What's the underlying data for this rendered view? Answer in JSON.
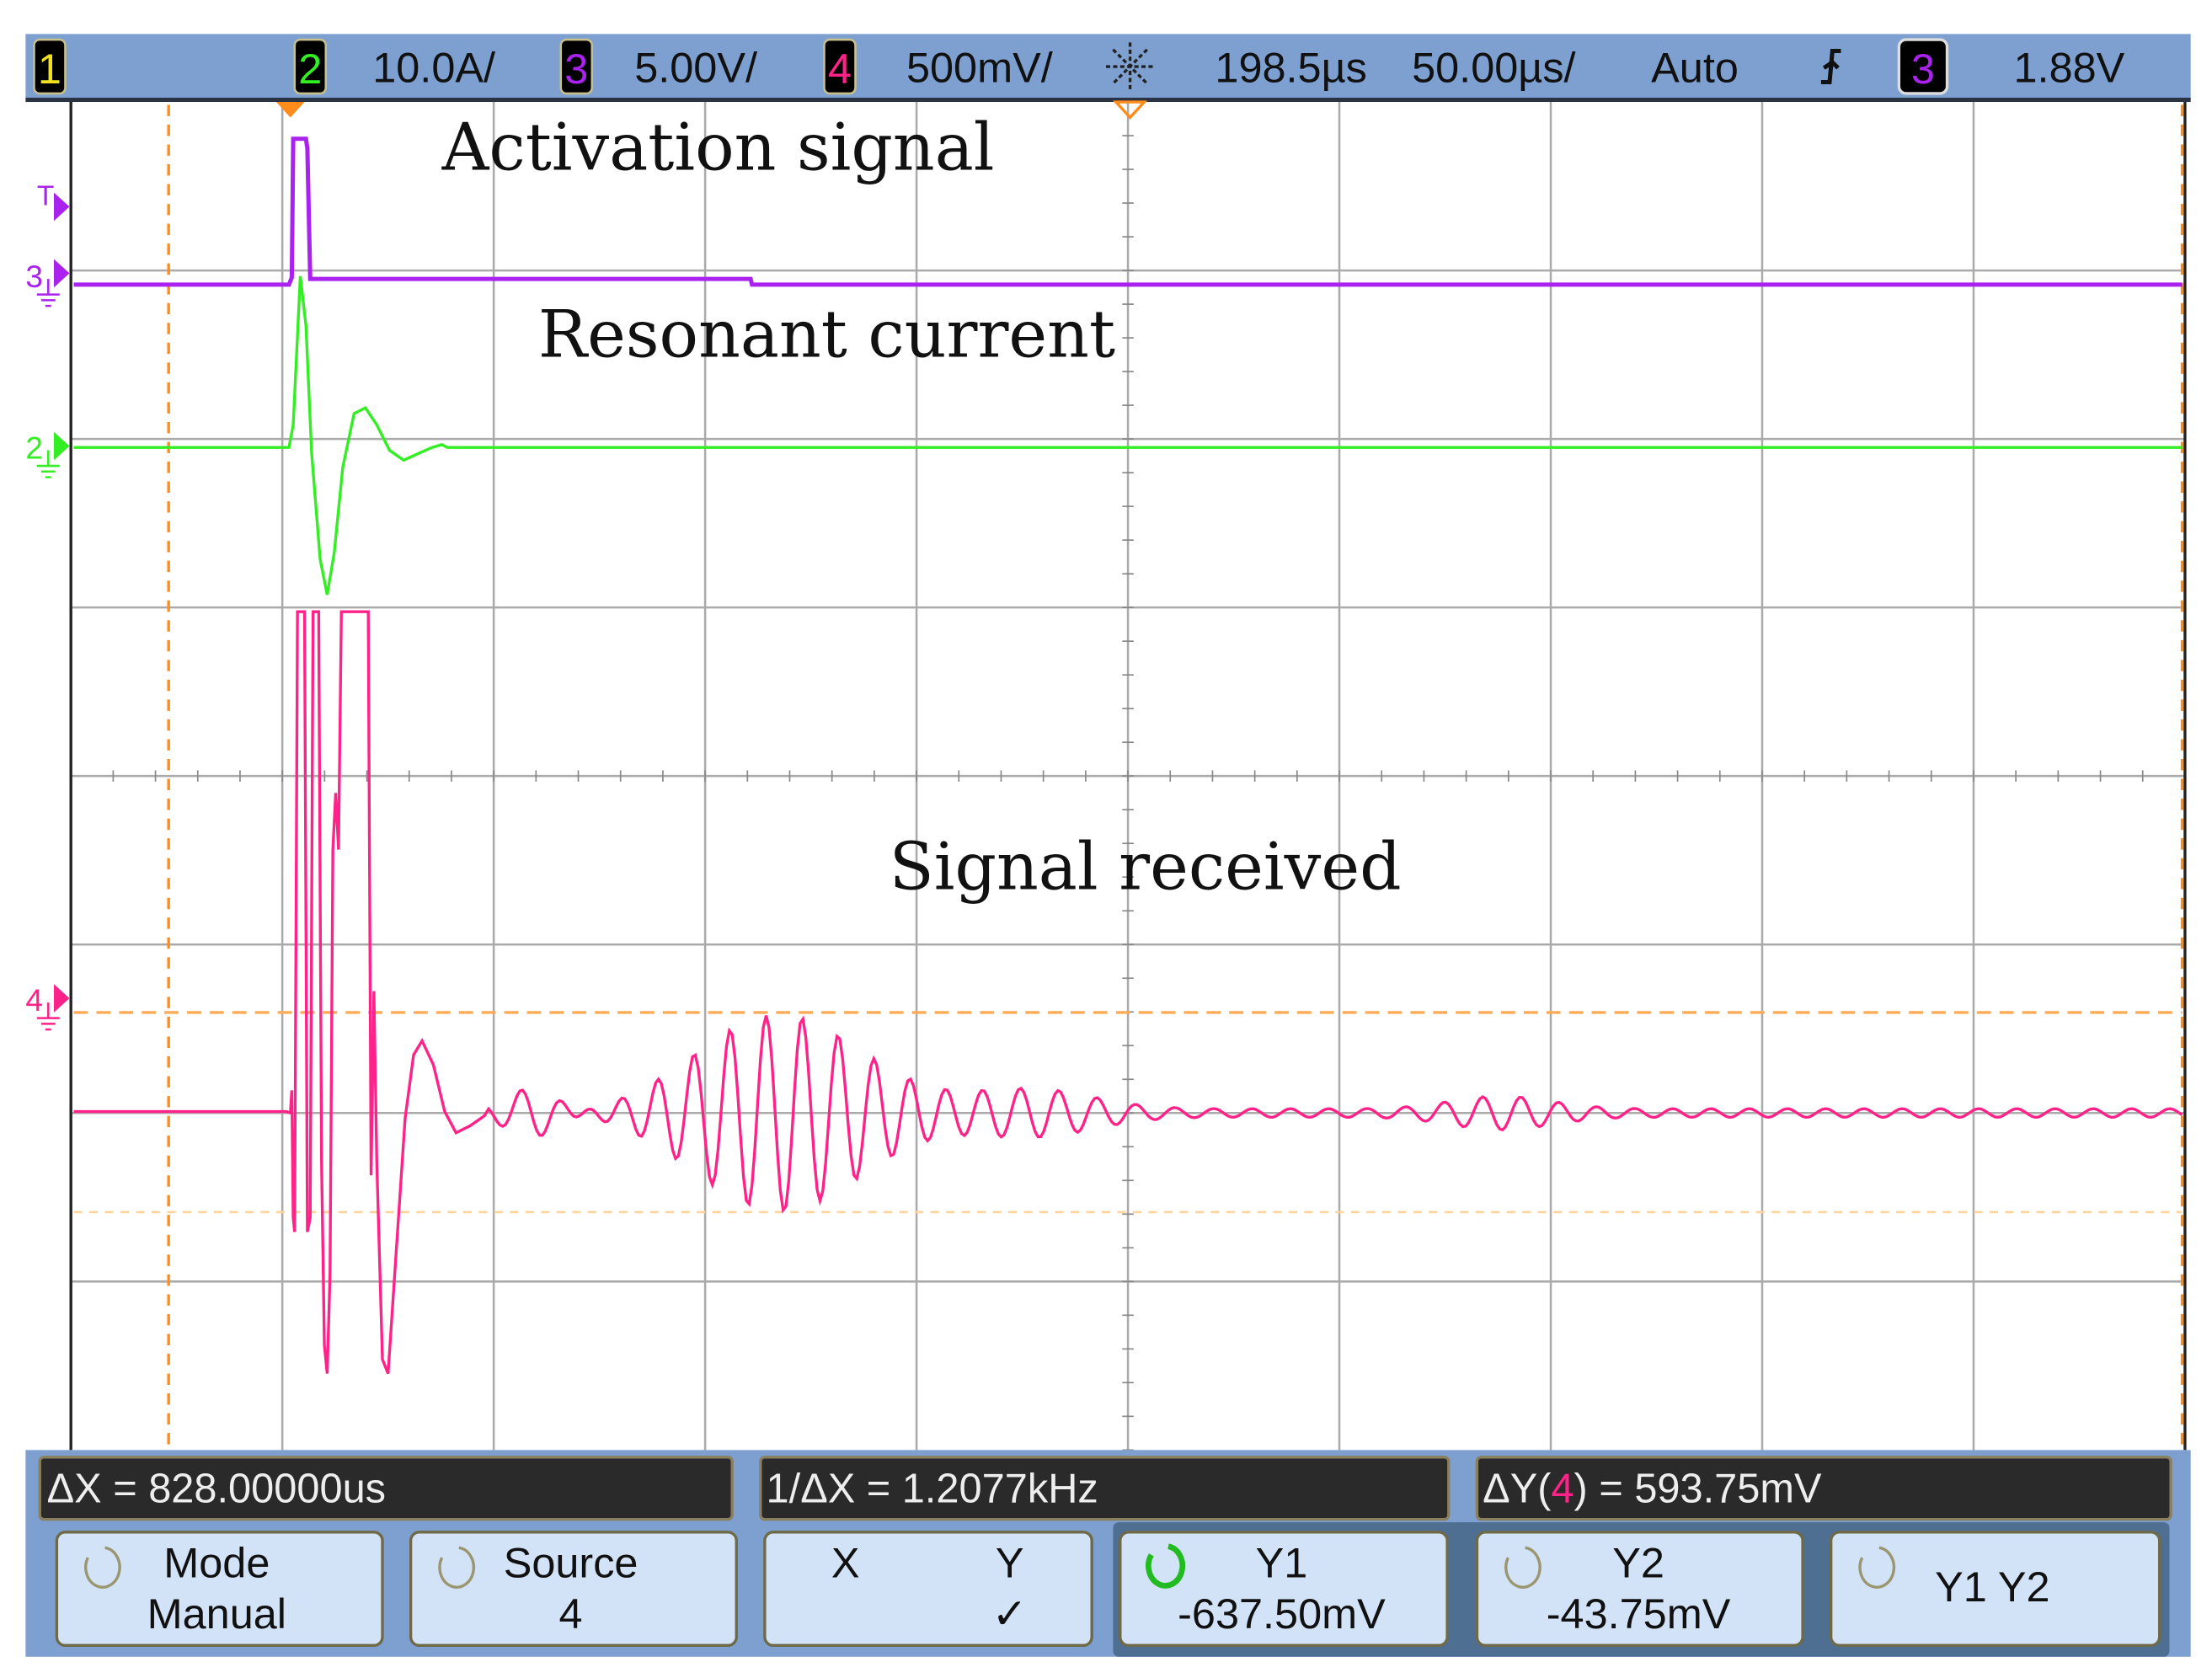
{
  "status_bar": {
    "ch1_badge": "1",
    "ch2_badge": "2",
    "ch2_scale": "10.0A/",
    "ch3_badge": "3",
    "ch3_scale": "5.00V/",
    "ch4_badge": "4",
    "ch4_scale": "500mV/",
    "run_icon": "acquire-star-icon",
    "time_delay": "198.5µs",
    "time_scale": "50.00µs/",
    "trigger_mode": "Auto",
    "trigger_slope_icon": "rising-edge-icon",
    "trigger_source_badge": "3",
    "trigger_level": "1.88V"
  },
  "colors": {
    "ch1": "#f0e020",
    "ch2": "#33ee22",
    "ch3": "#aa22ee",
    "ch4": "#ff2288",
    "cursor": "#ff8c1a",
    "bar_blue": "#7ea0d0",
    "button_blue": "#d3e3f7"
  },
  "annotations": {
    "activation": "Activation signal",
    "resonant": "Resonant current",
    "received": "Signal received"
  },
  "markers": {
    "trigger": "T",
    "ch3": "3",
    "ch2": "2",
    "ch4": "4"
  },
  "measurements": {
    "delta_x": "ΔX = 828.00000us",
    "inv_delta_x": "1/ΔX = 1.2077kHz",
    "delta_y_prefix": "ΔY(",
    "delta_y_channel": "4",
    "delta_y_suffix": ") = 593.75mV"
  },
  "softkeys": [
    {
      "line1": "Mode",
      "line2": "Manual"
    },
    {
      "line1": "Source",
      "line2": "4"
    },
    {
      "x": "X",
      "y": "Y",
      "check": "✓"
    },
    {
      "line1": "Y1",
      "line2": "-637.50mV"
    },
    {
      "line1": "Y2",
      "line2": "-43.75mV"
    },
    {
      "line1": "Y1 Y2"
    }
  ]
}
